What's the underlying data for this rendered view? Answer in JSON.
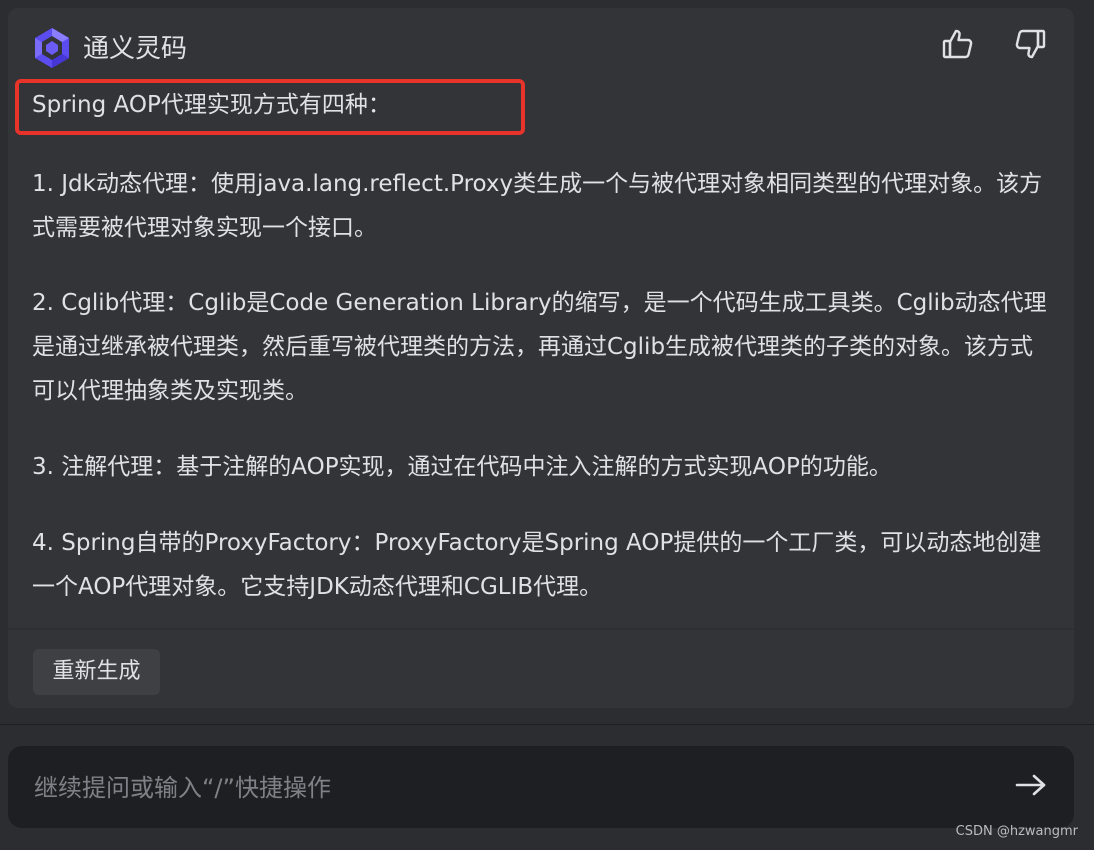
{
  "assistant": {
    "name": "通义灵码",
    "logo_icon": "tongyi-lingma-logo",
    "thumbs_up_icon": "thumbs-up-icon",
    "thumbs_down_icon": "thumbs-down-icon"
  },
  "answer": {
    "intro": "Spring AOP代理实现方式有四种：",
    "items": [
      "1. Jdk动态代理：使用java.lang.reflect.Proxy类生成一个与被代理对象相同类型的代理对象。该方式需要被代理对象实现一个接口。",
      "2. Cglib代理：Cglib是Code Generation Library的缩写，是一个代码生成工具类。Cglib动态代理是通过继承被代理类，然后重写被代理类的方法，再通过Cglib生成被代理类的子类的对象。该方式可以代理抽象类及实现类。",
      "3. 注解代理：基于注解的AOP实现，通过在代码中注入注解的方式实现AOP的功能。",
      "4. Spring自带的ProxyFactory：ProxyFactory是Spring AOP提供的一个工厂类，可以动态地创建一个AOP代理对象。它支持JDK动态代理和CGLIB代理。"
    ]
  },
  "actions": {
    "regenerate_label": "重新生成"
  },
  "input": {
    "placeholder": "继续提问或输入“/”快捷操作",
    "value": "",
    "send_icon": "arrow-right-icon"
  },
  "watermark": "CSDN @hzwangmr",
  "colors": {
    "background": "#2b2d30",
    "card": "#323438",
    "text": "#dfe1e5",
    "highlight_border": "#e8332b",
    "input_background": "#1e1f22",
    "logo_purple": "#6b5cf6"
  }
}
